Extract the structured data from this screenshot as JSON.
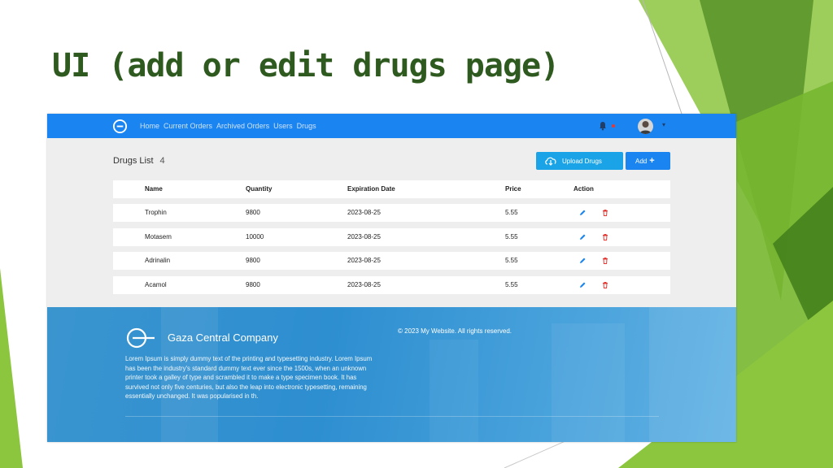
{
  "slide": {
    "title": "UI (add or edit drugs page)",
    "colors": {
      "title": "#2f5a1f",
      "accent_light": "#8cc63f",
      "accent_dark": "#4f8a22"
    }
  },
  "app": {
    "colors": {
      "nav": "#1a84f0",
      "upload": "#1aa3e6",
      "add": "#1a84f0",
      "delete": "#e53935",
      "edit": "#1a84f0"
    },
    "nav": {
      "logo_icon": "g-logo-icon",
      "links": [
        "Home",
        "Current Orders",
        "Archived Orders",
        "Users",
        "Drugs"
      ],
      "bell_icon": "bell-icon",
      "avatar_icon": "avatar",
      "caret_icon": "chevron-down-icon"
    },
    "list": {
      "title": "Drugs List",
      "count": "4",
      "upload_label": "Upload Drugs",
      "upload_icon": "cloud-download-icon",
      "add_label": "Add",
      "add_icon": "plus-icon"
    },
    "table": {
      "headers": [
        "Name",
        "Quantity",
        "Expiration Date",
        "Price",
        "Action"
      ],
      "rows": [
        {
          "name": "Trophin",
          "quantity": "9800",
          "expiration": "2023-08-25",
          "price": "5.55"
        },
        {
          "name": "Motasem",
          "quantity": "10000",
          "expiration": "2023-08-25",
          "price": "5.55"
        },
        {
          "name": "Adrinalin",
          "quantity": "9800",
          "expiration": "2023-08-25",
          "price": "5.55"
        },
        {
          "name": "Acamol",
          "quantity": "9800",
          "expiration": "2023-08-25",
          "price": "5.55"
        }
      ],
      "edit_icon": "pencil-icon",
      "delete_icon": "trash-icon"
    },
    "footer": {
      "company": "Gaza Central Company",
      "copyright": "© 2023 My Website. All rights reserved.",
      "description": "Lorem Ipsum is simply dummy text of the printing and typesetting industry. Lorem Ipsum has been the industry's standard dummy text ever since the 1500s, when an unknown printer took a galley of type and scrambled it to make a type specimen book. It has survived not only five centuries, but also the leap into electronic typesetting, remaining essentially unchanged. It was popularised in th."
    }
  }
}
